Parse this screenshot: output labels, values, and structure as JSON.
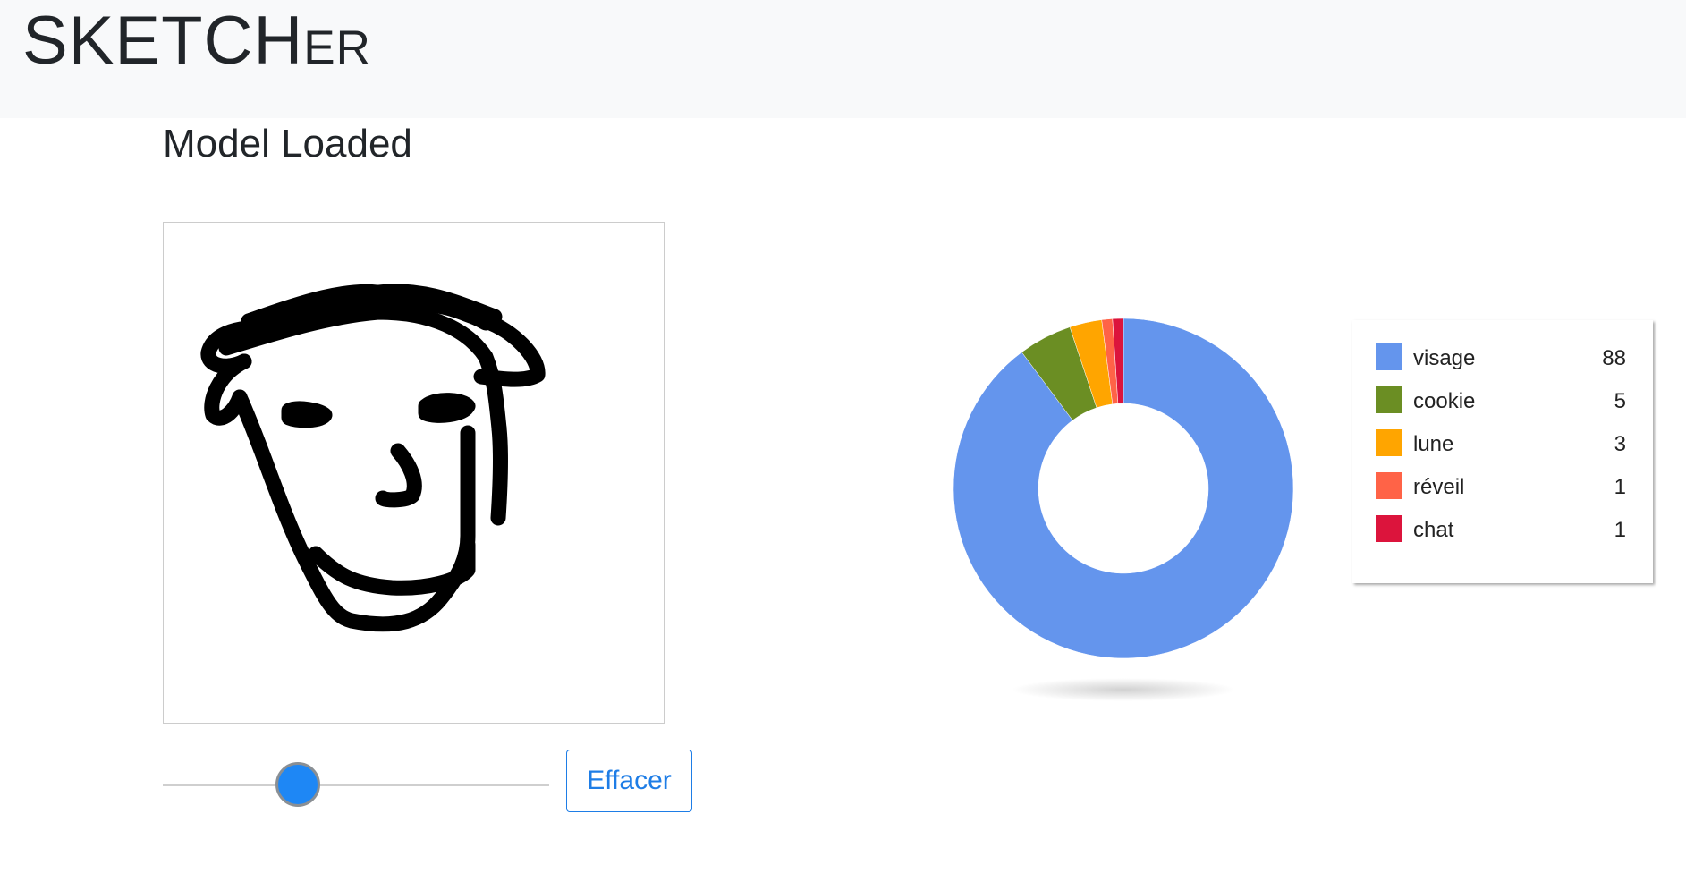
{
  "app": {
    "title": "SKETCHer"
  },
  "status": {
    "text": "Model Loaded"
  },
  "controls": {
    "clear_label": "Effacer",
    "brush_slider": {
      "value_fraction": 0.35
    }
  },
  "colors": {
    "navbar_bg": "#f8f9fa",
    "accent": "#1e87f5",
    "button_text": "#1e7de6"
  },
  "chart_data": {
    "type": "pie",
    "variant": "donut",
    "legend_placement": "right",
    "slices": [
      {
        "label": "visage",
        "value": 88,
        "color": "#6495ed"
      },
      {
        "label": "cookie",
        "value": 5,
        "color": "#6b8e23"
      },
      {
        "label": "lune",
        "value": 3,
        "color": "#ffa500"
      },
      {
        "label": "réveil",
        "value": 1,
        "color": "#ff6347"
      },
      {
        "label": "chat",
        "value": 1,
        "color": "#dc143c"
      }
    ]
  }
}
